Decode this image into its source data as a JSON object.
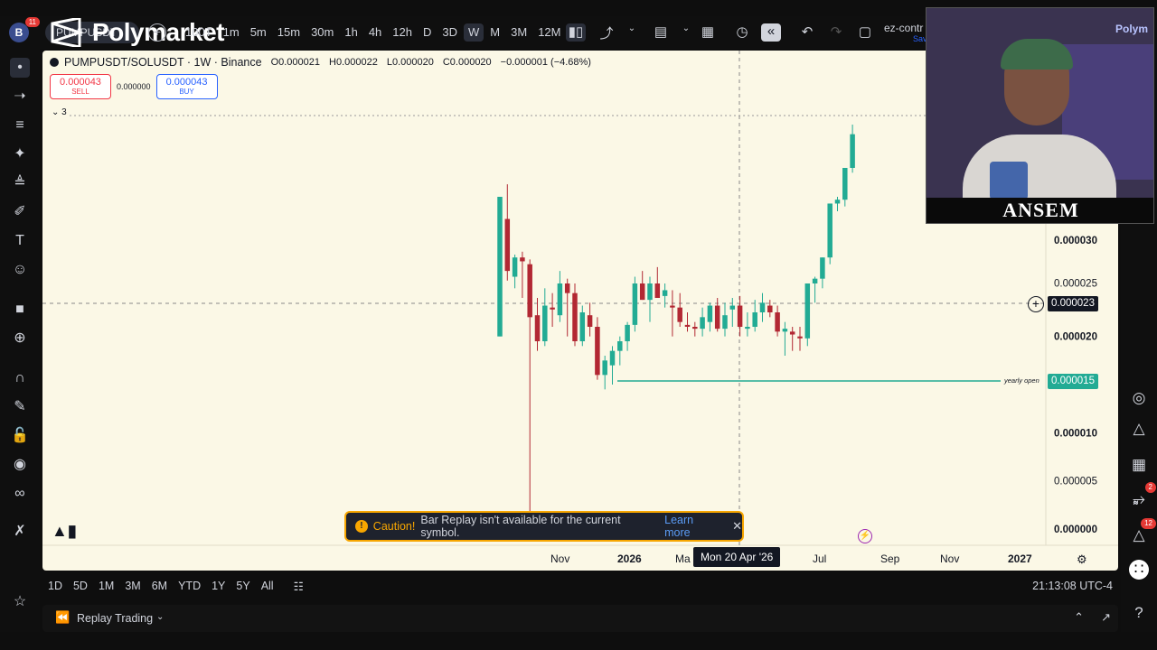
{
  "top": {
    "avatar_letter": "B",
    "avatar_badge": "11",
    "symbol_pill": "PUMPUSDT",
    "overlay_brand": "Polymarket",
    "intervals": [
      "100T",
      "1m",
      "5m",
      "15m",
      "30m",
      "1h",
      "4h",
      "12h",
      "D",
      "3D",
      "W",
      "M",
      "3M",
      "12M"
    ],
    "active_interval": "W",
    "layout_name": "ez-contr",
    "layout_sub": "Sav"
  },
  "legend": {
    "symbol": "PUMPUSDT/SOLUSDT · 1W · Binance",
    "open": "O0.000021",
    "high": "H0.000022",
    "low": "L0.000020",
    "close": "C0.000020",
    "change": "−0.000001 (−4.68%)"
  },
  "trade": {
    "sell_price": "0.000043",
    "sell_label": "SELL",
    "spread": "0.000000",
    "buy_price": "0.000043",
    "buy_label": "BUY"
  },
  "indicators_collapsed": "3",
  "price_axis": [
    "0.000030",
    "0.000025",
    "0.000020",
    "0.000010",
    "0.000005",
    "0.000000"
  ],
  "crosshair_price": "0.000023",
  "yearly_open_label": "yearly open",
  "yearly_open_price": "0.000015",
  "time_axis": [
    "Nov",
    "2026",
    "Ma",
    "Jul",
    "Sep",
    "Nov",
    "2027"
  ],
  "crosshair_date": "Mon 20 Apr '26",
  "caution": {
    "title": "Caution!",
    "message": "Bar Replay isn't available for the current symbol.",
    "link": "Learn more"
  },
  "ranges": [
    "1D",
    "5D",
    "1M",
    "3M",
    "6M",
    "YTD",
    "1Y",
    "5Y",
    "All"
  ],
  "clock": "21:13:08 UTC-4",
  "replay_label": "Replay Trading",
  "right_badges": {
    "signals": "2",
    "alerts": "12"
  },
  "webcam_name": "ANSEM",
  "webcam_brand": "Polym",
  "colors": {
    "up": "#22ab94",
    "down": "#b22833",
    "background": "#fbf8e6",
    "yearly_open": "#22ab94",
    "caution_border": "#f7a600"
  },
  "chart_data": {
    "type": "candlestick",
    "ylim": [
      0,
      3.45e-05
    ],
    "candles": [
      {
        "o": 2e-05,
        "h": 2.45e-05,
        "l": 2e-05,
        "c": 3.45e-05,
        "up": true
      },
      {
        "o": 3.22e-05,
        "h": 3.58e-05,
        "l": 2.58e-05,
        "c": 2.68e-05,
        "up": false
      },
      {
        "o": 2.62e-05,
        "h": 2.85e-05,
        "l": 2.5e-05,
        "c": 2.82e-05,
        "up": true
      },
      {
        "o": 2.82e-05,
        "h": 2.88e-05,
        "l": 2.4e-05,
        "c": 2.78e-05,
        "up": false
      },
      {
        "o": 2.75e-05,
        "h": 2.8e-05,
        "l": 0.0,
        "c": 2.2e-05,
        "up": false
      },
      {
        "o": 2.22e-05,
        "h": 2.4e-05,
        "l": 1.85e-05,
        "c": 1.95e-05,
        "up": false
      },
      {
        "o": 1.95e-05,
        "h": 2.5e-05,
        "l": 1.9e-05,
        "c": 2.32e-05,
        "up": true
      },
      {
        "o": 2.3e-05,
        "h": 2.45e-05,
        "l": 2.1e-05,
        "c": 2.28e-05,
        "up": false
      },
      {
        "o": 2.22e-05,
        "h": 2.68e-05,
        "l": 2.15e-05,
        "c": 2.55e-05,
        "up": true
      },
      {
        "o": 2.55e-05,
        "h": 2.6e-05,
        "l": 2e-05,
        "c": 2.45e-05,
        "up": false
      },
      {
        "o": 2.45e-05,
        "h": 2.55e-05,
        "l": 1.9e-05,
        "c": 1.95e-05,
        "up": false
      },
      {
        "o": 1.95e-05,
        "h": 2.32e-05,
        "l": 1.9e-05,
        "c": 2.25e-05,
        "up": true
      },
      {
        "o": 2.22e-05,
        "h": 2.35e-05,
        "l": 2e-05,
        "c": 2.1e-05,
        "up": false
      },
      {
        "o": 2.1e-05,
        "h": 2.2e-05,
        "l": 1.55e-05,
        "c": 1.6e-05,
        "up": false
      },
      {
        "o": 1.6e-05,
        "h": 1.8e-05,
        "l": 1.45e-05,
        "c": 1.75e-05,
        "up": true
      },
      {
        "o": 1.7e-05,
        "h": 1.9e-05,
        "l": 1.5e-05,
        "c": 1.85e-05,
        "up": true
      },
      {
        "o": 1.85e-05,
        "h": 2e-05,
        "l": 1.7e-05,
        "c": 1.95e-05,
        "up": true
      },
      {
        "o": 1.95e-05,
        "h": 2.15e-05,
        "l": 1.85e-05,
        "c": 2.12e-05,
        "up": true
      },
      {
        "o": 2.12e-05,
        "h": 2.62e-05,
        "l": 2.05e-05,
        "c": 2.55e-05,
        "up": true
      },
      {
        "o": 2.55e-05,
        "h": 2.68e-05,
        "l": 2.4e-05,
        "c": 2.38e-05,
        "up": false
      },
      {
        "o": 2.38e-05,
        "h": 2.62e-05,
        "l": 2.15e-05,
        "c": 2.55e-05,
        "up": true
      },
      {
        "o": 2.55e-05,
        "h": 2.72e-05,
        "l": 2.4e-05,
        "c": 2.4e-05,
        "up": false
      },
      {
        "o": 2.42e-05,
        "h": 2.55e-05,
        "l": 2.3e-05,
        "c": 2.48e-05,
        "up": true
      },
      {
        "o": 2.32e-05,
        "h": 2.48e-05,
        "l": 2e-05,
        "c": 2.3e-05,
        "up": false
      },
      {
        "o": 2.3e-05,
        "h": 2.45e-05,
        "l": 2.1e-05,
        "c": 2.15e-05,
        "up": false
      },
      {
        "o": 2.12e-05,
        "h": 2.25e-05,
        "l": 2.05e-05,
        "c": 2.1e-05,
        "up": false
      },
      {
        "o": 2.1e-05,
        "h": 2.15e-05,
        "l": 2e-05,
        "c": 2.08e-05,
        "up": false
      },
      {
        "o": 2.08e-05,
        "h": 2.3e-05,
        "l": 2e-05,
        "c": 2.2e-05,
        "up": true
      },
      {
        "o": 2.15e-05,
        "h": 2.35e-05,
        "l": 2.05e-05,
        "c": 2.32e-05,
        "up": true
      },
      {
        "o": 2.32e-05,
        "h": 2.4e-05,
        "l": 2.05e-05,
        "c": 2.08e-05,
        "up": false
      },
      {
        "o": 2.08e-05,
        "h": 2.35e-05,
        "l": 2e-05,
        "c": 2.22e-05,
        "up": true
      },
      {
        "o": 2.28e-05,
        "h": 2.4e-05,
        "l": 2.1e-05,
        "c": 2.32e-05,
        "up": true
      },
      {
        "o": 2.32e-05,
        "h": 2.42e-05,
        "l": 2e-05,
        "c": 2.1e-05,
        "up": false
      },
      {
        "o": 2.08e-05,
        "h": 2.25e-05,
        "l": 2e-05,
        "c": 2.1e-05,
        "up": true
      },
      {
        "o": 2.1e-05,
        "h": 2.38e-05,
        "l": 2.05e-05,
        "c": 2.25e-05,
        "up": true
      },
      {
        "o": 2.25e-05,
        "h": 2.45e-05,
        "l": 2.15e-05,
        "c": 2.35e-05,
        "up": true
      },
      {
        "o": 2.32e-05,
        "h": 2.38e-05,
        "l": 2.2e-05,
        "c": 2.25e-05,
        "up": false
      },
      {
        "o": 2.25e-05,
        "h": 2.32e-05,
        "l": 2e-05,
        "c": 2.05e-05,
        "up": false
      },
      {
        "o": 2.05e-05,
        "h": 2.15e-05,
        "l": 1.8e-05,
        "c": 2.08e-05,
        "up": true
      },
      {
        "o": 2.05e-05,
        "h": 2.1e-05,
        "l": 1.85e-05,
        "c": 2.02e-05,
        "up": false
      },
      {
        "o": 2e-05,
        "h": 2.1e-05,
        "l": 1.85e-05,
        "c": 1.98e-05,
        "up": false
      },
      {
        "o": 1.98e-05,
        "h": 2.15e-05,
        "l": 1.9e-05,
        "c": 2.55e-05,
        "up": true
      },
      {
        "o": 2.55e-05,
        "h": 2.62e-05,
        "l": 2.35e-05,
        "c": 2.6e-05,
        "up": true
      },
      {
        "o": 2.6e-05,
        "h": 2.65e-05,
        "l": 2.5e-05,
        "c": 2.82e-05,
        "up": true
      },
      {
        "o": 2.82e-05,
        "h": 2.9e-05,
        "l": 2.75e-05,
        "c": 3.38e-05,
        "up": true
      },
      {
        "o": 3.38e-05,
        "h": 3.45e-05,
        "l": 3.3e-05,
        "c": 3.42e-05,
        "up": true
      },
      {
        "o": 3.42e-05,
        "h": 3.5e-05,
        "l": 3.35e-05,
        "c": 3.75e-05,
        "up": true
      },
      {
        "o": 3.75e-05,
        "h": 4.2e-05,
        "l": 3.7e-05,
        "c": 4.1e-05,
        "up": true
      }
    ]
  }
}
